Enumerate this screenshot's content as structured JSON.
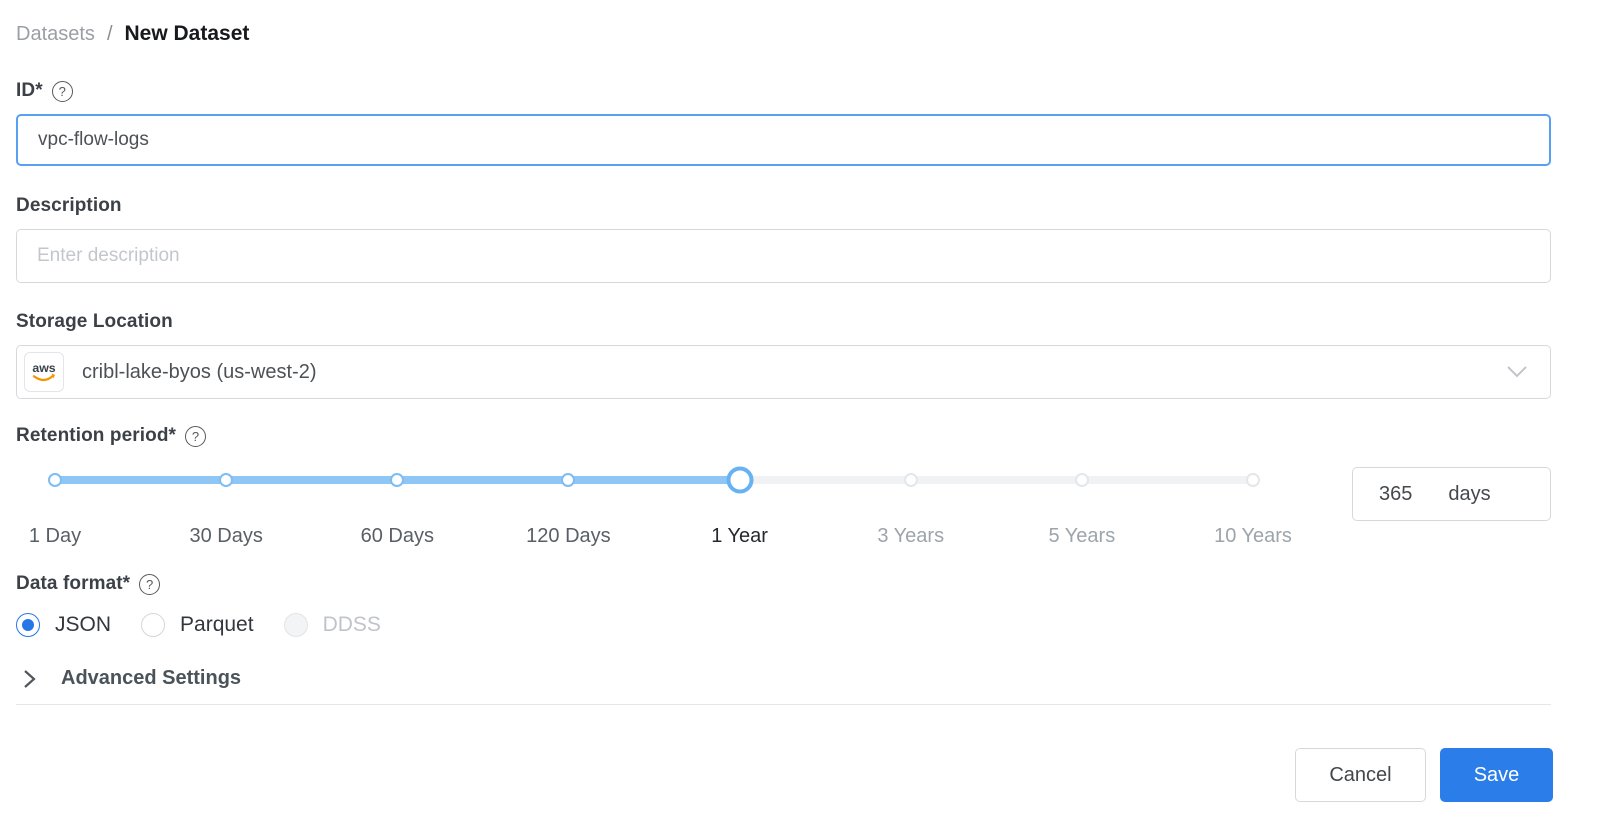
{
  "breadcrumb": {
    "parent": "Datasets",
    "separator": "/",
    "current": "New Dataset"
  },
  "form": {
    "id": {
      "label": "ID*",
      "value": "vpc-flow-logs",
      "help_icon": "question-circle-icon"
    },
    "description": {
      "label": "Description",
      "placeholder": "Enter description"
    },
    "storage_location": {
      "label": "Storage Location",
      "selected": "cribl-lake-byos (us-west-2)",
      "provider_logo_text": "aws",
      "dropdown_icon": "chevron-down-icon"
    },
    "retention_period": {
      "label": "Retention period*",
      "help_icon": "question-circle-icon",
      "marks": [
        "1 Day",
        "30 Days",
        "60 Days",
        "120 Days",
        "1 Year",
        "3 Years",
        "5 Years",
        "10 Years"
      ],
      "selected_mark": "1 Year",
      "selected_index": 4,
      "value": "365",
      "unit": "days"
    },
    "data_format": {
      "label": "Data format*",
      "help_icon": "question-circle-icon",
      "options": [
        {
          "label": "JSON",
          "state": "selected"
        },
        {
          "label": "Parquet",
          "state": "unselected"
        },
        {
          "label": "DDSS",
          "state": "disabled"
        }
      ]
    }
  },
  "advanced_settings": {
    "label": "Advanced Settings",
    "expand_icon": "chevron-right-icon"
  },
  "buttons": {
    "cancel": "Cancel",
    "save": "Save"
  },
  "help_glyph": "?",
  "colors": {
    "accent_blue": "#2b7de9",
    "focus_border": "#57a0f2",
    "slider_fill": "#8ec6f5",
    "slider_handle_border": "#67b2f3",
    "radio_blue": "#2677e8",
    "aws_orange": "#f79400"
  }
}
